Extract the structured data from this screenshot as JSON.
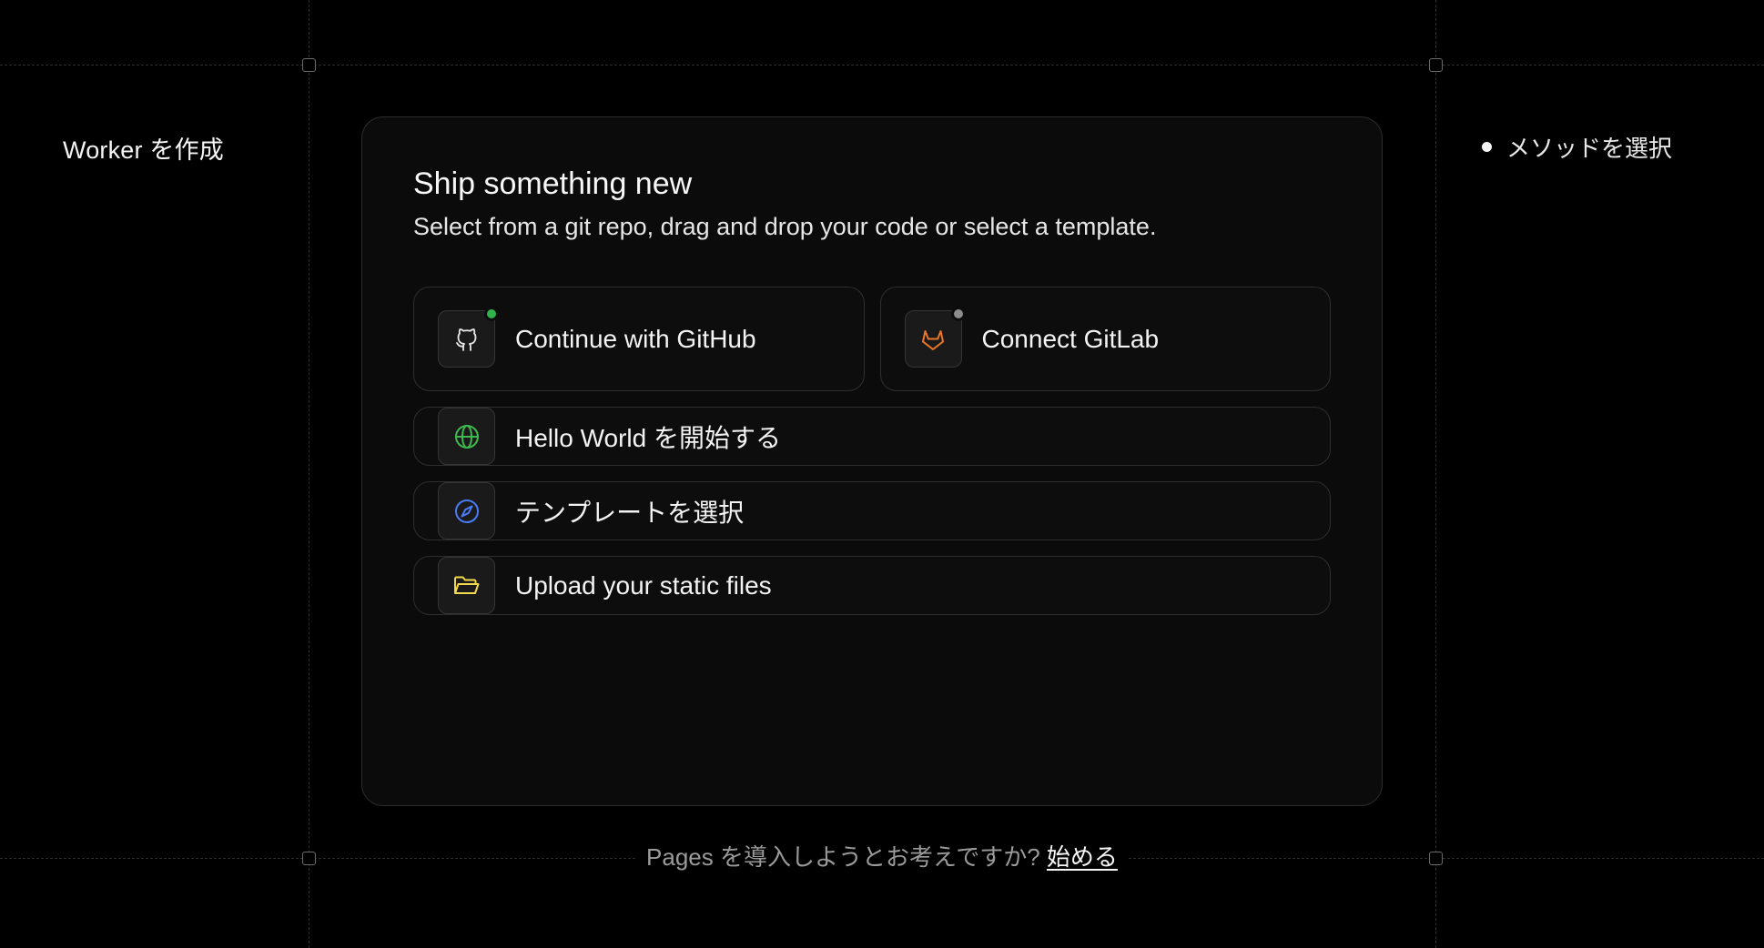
{
  "sidebar": {
    "title": "Worker を作成"
  },
  "steps": [
    {
      "label": "メソッドを選択",
      "active": true
    }
  ],
  "card": {
    "title": "Ship something new",
    "subtitle": "Select from a git repo, drag and drop your code or select a template."
  },
  "options": {
    "github": {
      "label": "Continue with GitHub",
      "icon": "github-icon",
      "status": "connected",
      "status_color": "#2fb34a"
    },
    "gitlab": {
      "label": "Connect GitLab",
      "icon": "gitlab-icon",
      "status": "disconnected",
      "status_color": "#8c8c8c"
    },
    "hello_world": {
      "label": "Hello World を開始する",
      "icon": "globe-icon",
      "icon_color": "#3fb950"
    },
    "template": {
      "label": "テンプレートを選択",
      "icon": "compass-icon",
      "icon_color": "#4a7cf7"
    },
    "upload": {
      "label": "Upload your static files",
      "icon": "folder-icon",
      "icon_color": "#f2d84a"
    }
  },
  "footer": {
    "text": "Pages を導入しようとお考えですか?",
    "link": "始める"
  },
  "colors": {
    "background": "#000000",
    "card": "#0b0b0b",
    "border": "#2e2e2e",
    "gitlab_orange": "#e8772a"
  }
}
